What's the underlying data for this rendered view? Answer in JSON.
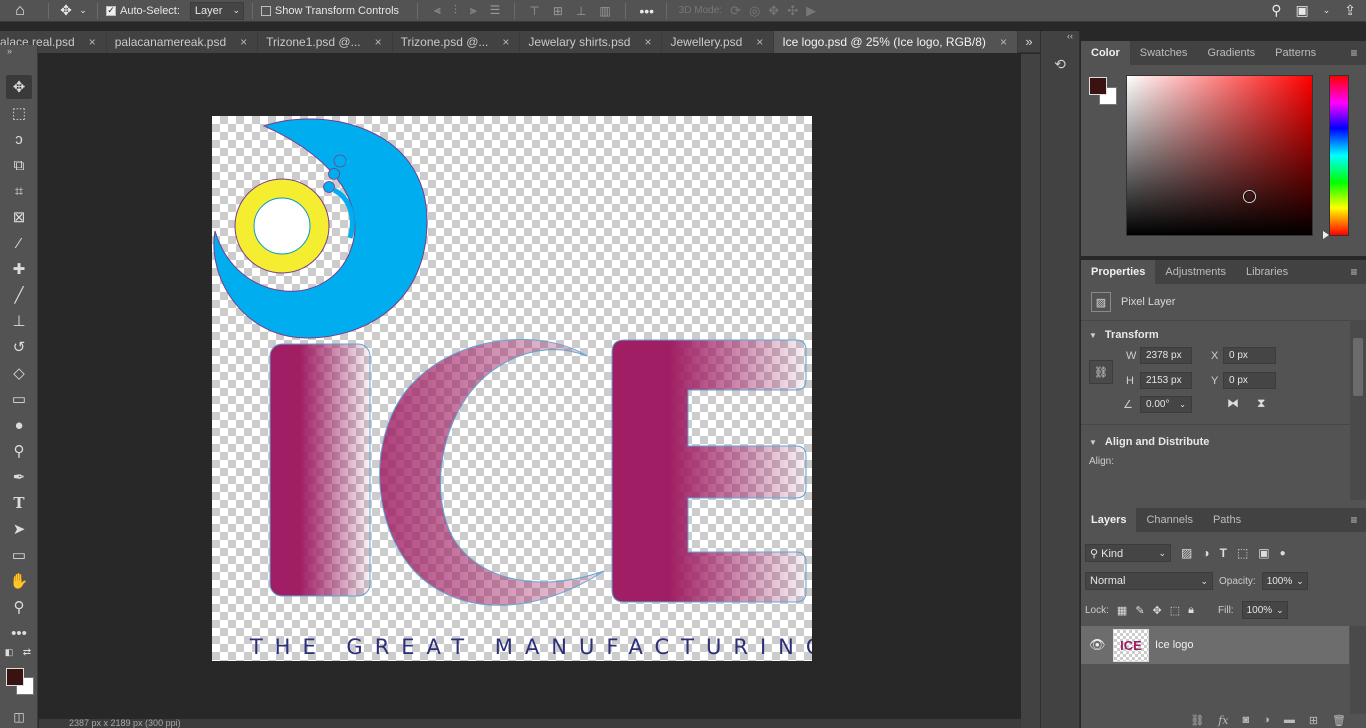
{
  "options_bar": {
    "auto_select_label": "Auto-Select:",
    "auto_select_checked": true,
    "auto_select_target": "Layer",
    "show_transform_label": "Show Transform Controls",
    "show_transform_checked": false,
    "mode_3d_label": "3D Mode:"
  },
  "tabs": [
    {
      "label": "alace real.psd",
      "active": false
    },
    {
      "label": "palacanamereak.psd",
      "active": false
    },
    {
      "label": "Trizone1.psd @...",
      "active": false
    },
    {
      "label": "Trizone.psd @...",
      "active": false
    },
    {
      "label": "Jewelary shirts.psd",
      "active": false
    },
    {
      "label": "Jewellery.psd",
      "active": false
    },
    {
      "label": "Ice logo.psd @ 25% (Ice logo, RGB/8)",
      "active": true
    }
  ],
  "artwork": {
    "letters": "ICE",
    "tagline": "THE GREAT MANUFACTURING"
  },
  "status": {
    "doc_size": "2387 px x 2189 px (300 ppi)"
  },
  "colors": {
    "foreground": "#3b1212",
    "background": "#ffffff",
    "accent_magenta": "#a01f64",
    "logo_blue": "#00aeef",
    "logo_yellow": "#f5ee30"
  },
  "color_panel": {
    "tabs": [
      "Color",
      "Swatches",
      "Gradients",
      "Patterns"
    ],
    "active_tab": "Color"
  },
  "properties_panel": {
    "tabs": [
      "Properties",
      "Adjustments",
      "Libraries"
    ],
    "active_tab": "Properties",
    "layer_type": "Pixel Layer",
    "transform_title": "Transform",
    "w_label": "W",
    "w_value": "2378 px",
    "h_label": "H",
    "h_value": "2153 px",
    "x_label": "X",
    "x_value": "0 px",
    "y_label": "Y",
    "y_value": "0 px",
    "angle_value": "0.00°",
    "align_title": "Align and Distribute",
    "align_label": "Align:"
  },
  "layers_panel": {
    "tabs": [
      "Layers",
      "Channels",
      "Paths"
    ],
    "active_tab": "Layers",
    "filter_kind": "Kind",
    "blend_mode": "Normal",
    "opacity_label": "Opacity:",
    "opacity_value": "100%",
    "lock_label": "Lock:",
    "fill_label": "Fill:",
    "fill_value": "100%",
    "layers": [
      {
        "name": "Ice logo",
        "visible": true
      }
    ]
  }
}
